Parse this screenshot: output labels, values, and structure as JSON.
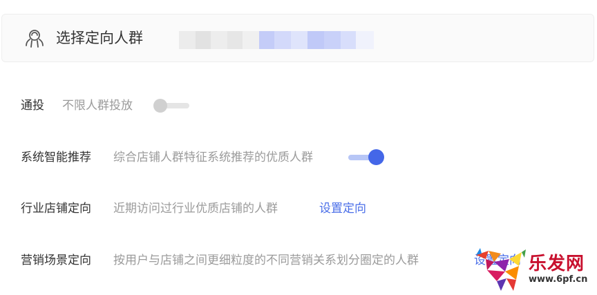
{
  "header": {
    "title": "选择定向人群",
    "icon": "targeting-people-icon"
  },
  "rows": [
    {
      "label": "通投",
      "desc": "不限人群投放",
      "toggle": "off"
    },
    {
      "label": "系统智能推荐",
      "desc": "综合店铺人群特征系统推荐的优质人群",
      "toggle": "on"
    },
    {
      "label": "行业店铺定向",
      "desc": "近期访问过行业优质店铺的人群",
      "link": "设置定向"
    },
    {
      "label": "营销场景定向",
      "desc": "按用户与店铺之间更细粒度的不同营销关系划分圈定的人群",
      "link": "设置定向"
    }
  ],
  "watermark": {
    "text": "乐发网",
    "url": "www.6pf.cn"
  },
  "colors": {
    "accent": "#4467e8",
    "link": "#4a6ee8",
    "text": "#333333",
    "muted": "#9b9b9b"
  }
}
